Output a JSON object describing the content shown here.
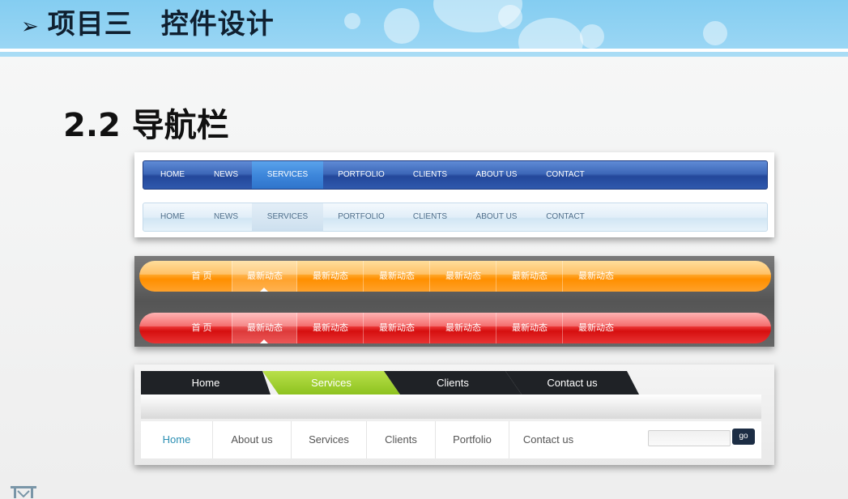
{
  "header": {
    "title": "项目三　控件设计",
    "arrow": "➢"
  },
  "section": {
    "title": "2.2  导航栏"
  },
  "nav_blue": {
    "items": [
      "HOME",
      "NEWS",
      "SERVICES",
      "PORTFOLIO",
      "CLIENTS",
      "ABOUT US",
      "CONTACT"
    ],
    "active": "SERVICES"
  },
  "nav_light": {
    "items": [
      "HOME",
      "NEWS",
      "SERVICES",
      "PORTFOLIO",
      "CLIENTS",
      "ABOUT US",
      "CONTACT"
    ],
    "active": "SERVICES"
  },
  "pill_orange": {
    "items": [
      "首 页",
      "最新动态",
      "最新动态",
      "最新动态",
      "最新动态",
      "最新动态",
      "最新动态"
    ],
    "active_index": 1
  },
  "pill_red": {
    "items": [
      "首 页",
      "最新动态",
      "最新动态",
      "最新动态",
      "最新动态",
      "最新动态",
      "最新动态"
    ],
    "active_index": 1
  },
  "tabs": {
    "items": [
      "Home",
      "Services",
      "Clients",
      "Contact us"
    ],
    "active": "Services"
  },
  "menu": {
    "items": [
      "Home",
      "About us",
      "Services",
      "Clients",
      "Portfolio",
      "Contact us"
    ],
    "active": "Home",
    "search_placeholder": "",
    "go_label": "go"
  },
  "colors": {
    "header": "#8fd1f3",
    "blue_nav": "#2f59ad",
    "orange_pill": "#ff9a1a",
    "red_pill": "#e01e1e",
    "green_tab": "#8dc21f"
  }
}
